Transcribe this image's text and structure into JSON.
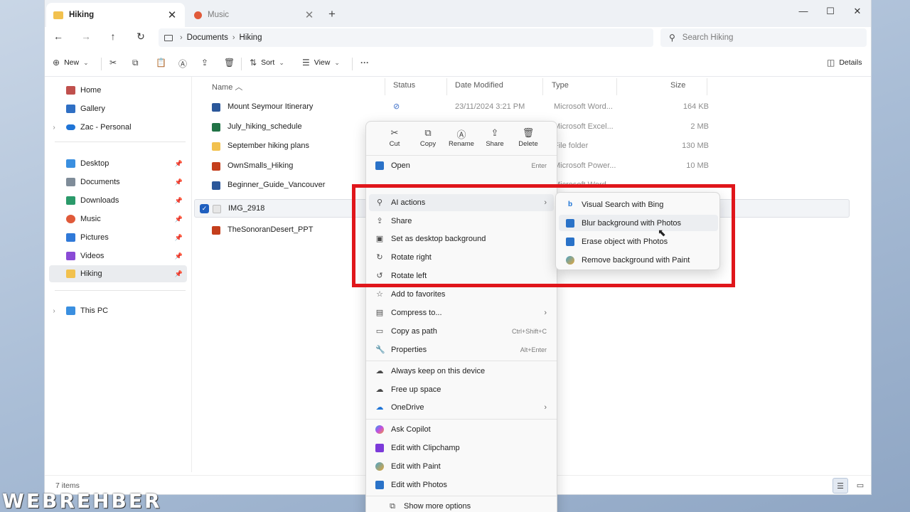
{
  "tabs": [
    {
      "label": "Hiking",
      "icon": "folder-icon",
      "active": true
    },
    {
      "label": "Music",
      "icon": "music-icon",
      "active": false
    }
  ],
  "window_controls": {
    "minimize": "—",
    "maximize": "☐",
    "close": "✕"
  },
  "address": {
    "crumbs": [
      "Documents",
      "Hiking"
    ]
  },
  "search": {
    "placeholder": "Search Hiking"
  },
  "toolbar": {
    "new_label": "New",
    "sort_label": "Sort",
    "view_label": "View",
    "more_label": "···",
    "details_label": "Details"
  },
  "sidebar": {
    "items": [
      {
        "label": "Home",
        "icon": "home-icon",
        "color": "#c0504d"
      },
      {
        "label": "Gallery",
        "icon": "gallery-icon",
        "color": "#2f6fc4"
      },
      {
        "label": "Zac - Personal",
        "icon": "onedrive-icon",
        "color": "#1f74d6"
      },
      {
        "label": "Desktop",
        "icon": "desktop-icon",
        "color": "#3a8fe0"
      },
      {
        "label": "Documents",
        "icon": "documents-icon",
        "color": "#7f8c99"
      },
      {
        "label": "Downloads",
        "icon": "downloads-icon",
        "color": "#2b9a6a"
      },
      {
        "label": "Music",
        "icon": "music-icon",
        "color": "#e05a3a"
      },
      {
        "label": "Pictures",
        "icon": "pictures-icon",
        "color": "#3079d8"
      },
      {
        "label": "Videos",
        "icon": "videos-icon",
        "color": "#8a4bd6"
      },
      {
        "label": "Hiking",
        "icon": "folder-icon",
        "color": "#f2c14e"
      },
      {
        "label": "This PC",
        "icon": "pc-icon",
        "color": "#3a8fe0"
      }
    ]
  },
  "columns": {
    "name": "Name",
    "status": "Status",
    "date": "Date Modified",
    "type": "Type",
    "size": "Size"
  },
  "files": [
    {
      "name": "Mount Seymour Itinerary",
      "status": "⊘",
      "date": "23/11/2024 3:21 PM",
      "type": "Microsoft Word...",
      "size": "164 KB",
      "icon": "word-icon",
      "color": "#2b579a"
    },
    {
      "name": "July_hiking_schedule",
      "status": "",
      "date": "",
      "type": "Microsoft Excel...",
      "size": "2 MB",
      "icon": "excel-icon",
      "color": "#217346"
    },
    {
      "name": "September hiking plans",
      "status": "",
      "date": "",
      "type": "File folder",
      "size": "130 MB",
      "icon": "folder-icon",
      "color": "#f2c14e"
    },
    {
      "name": "OwnSmalls_Hiking",
      "status": "",
      "date": "",
      "type": "Microsoft Power...",
      "size": "10 MB",
      "icon": "powerpoint-icon",
      "color": "#c43e1c"
    },
    {
      "name": "Beginner_Guide_Vancouver",
      "status": "",
      "date": "",
      "type": "Microsoft Word...",
      "size": "",
      "icon": "word-icon",
      "color": "#2b579a"
    },
    {
      "name": "IMG_2918",
      "status": "",
      "date": "",
      "type": "",
      "size": "",
      "icon": "image-icon",
      "color": "#cfcfcf"
    },
    {
      "name": "TheSonoranDesert_PPT",
      "status": "",
      "date": "",
      "type": "",
      "size": "",
      "icon": "powerpoint-icon",
      "color": "#c43e1c"
    }
  ],
  "statusbar": {
    "count": "7 items"
  },
  "context_menu": {
    "quick_actions": [
      {
        "label": "Cut",
        "icon": "cut-icon",
        "glyph": "✂"
      },
      {
        "label": "Copy",
        "icon": "copy-icon",
        "glyph": "⧉"
      },
      {
        "label": "Rename",
        "icon": "rename-icon",
        "glyph": "Ⓐ"
      },
      {
        "label": "Share",
        "icon": "share-icon",
        "glyph": "⇪"
      },
      {
        "label": "Delete",
        "icon": "delete-icon",
        "glyph": "🗑"
      }
    ],
    "items": [
      {
        "label": "Open",
        "shortcut": "Enter",
        "icon": "open-icon"
      },
      {
        "label": "AI actions",
        "shortcut": "›",
        "icon": "ai-actions-icon"
      },
      {
        "label": "Share",
        "shortcut": "",
        "icon": "share-icon"
      },
      {
        "label": "Set as desktop background",
        "shortcut": "",
        "icon": "wallpaper-icon"
      },
      {
        "label": "Rotate right",
        "shortcut": "",
        "icon": "rotate-right-icon"
      },
      {
        "label": "Rotate left",
        "shortcut": "",
        "icon": "rotate-left-icon"
      },
      {
        "label": "Add to favorites",
        "shortcut": "",
        "icon": "star-icon"
      },
      {
        "label": "Compress to...",
        "shortcut": "›",
        "icon": "zip-icon"
      },
      {
        "label": "Copy as path",
        "shortcut": "Ctrl+Shift+C",
        "icon": "path-icon"
      },
      {
        "label": "Properties",
        "shortcut": "Alt+Enter",
        "icon": "wrench-icon"
      },
      {
        "label": "Always keep on this device",
        "shortcut": "",
        "icon": "cloud-keep-icon"
      },
      {
        "label": "Free up space",
        "shortcut": "",
        "icon": "cloud-icon"
      },
      {
        "label": "OneDrive",
        "shortcut": "›",
        "icon": "onedrive-icon"
      },
      {
        "label": "Ask Copilot",
        "shortcut": "",
        "icon": "copilot-icon"
      },
      {
        "label": "Edit with Clipchamp",
        "shortcut": "",
        "icon": "clipchamp-icon"
      },
      {
        "label": "Edit with Paint",
        "shortcut": "",
        "icon": "paint-icon"
      },
      {
        "label": "Edit with Photos",
        "shortcut": "",
        "icon": "photos-icon"
      },
      {
        "label": "Show more options",
        "shortcut": "",
        "icon": "more-options-icon"
      }
    ]
  },
  "submenu": {
    "items": [
      {
        "label": "Visual Search with Bing",
        "icon": "bing-icon",
        "color": "#1e74d6"
      },
      {
        "label": "Blur background with Photos",
        "icon": "photos-icon",
        "color": "#2a72c8"
      },
      {
        "label": "Erase object with Photos",
        "icon": "photos-icon",
        "color": "#2a72c8"
      },
      {
        "label": "Remove background with Paint",
        "icon": "paint-icon",
        "color": "#4aa3c9"
      }
    ]
  },
  "watermark": "WEBREHBER"
}
